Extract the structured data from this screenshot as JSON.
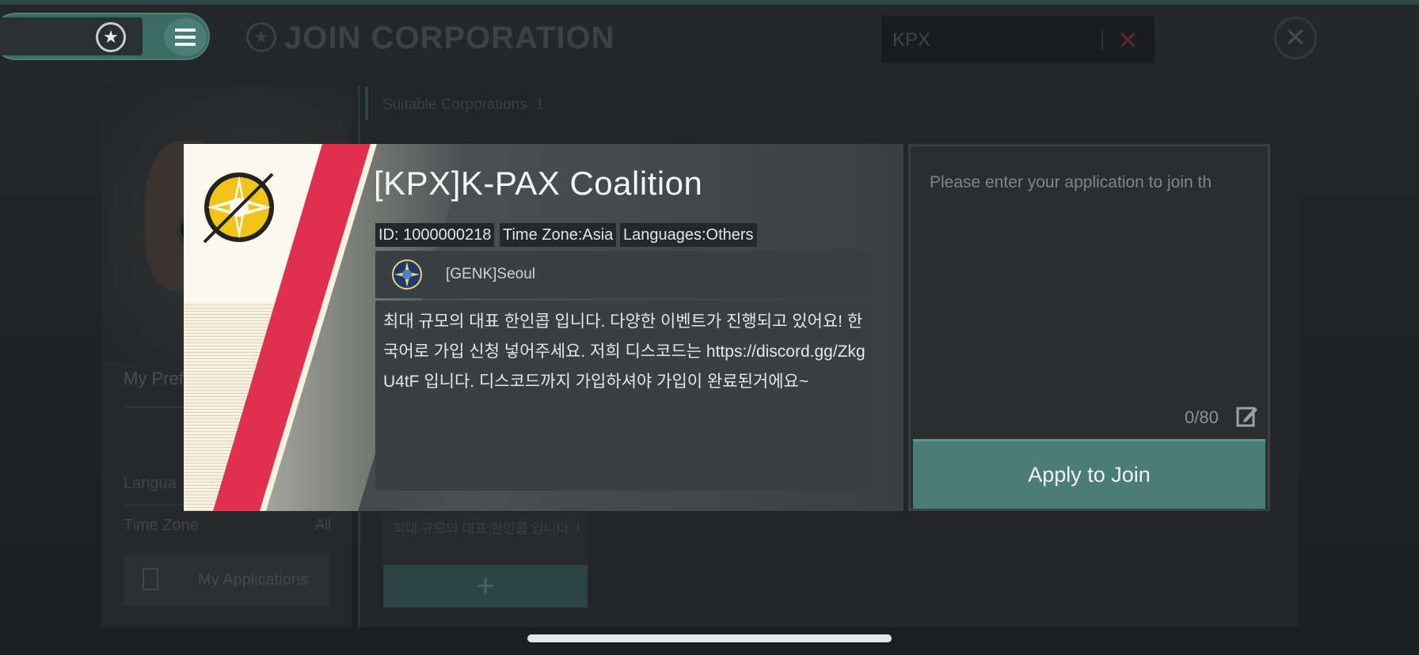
{
  "header": {
    "title": "JOIN CORPORATION",
    "search_value": "KPX"
  },
  "left_panel": {
    "preferences_label": "My Pref",
    "language_label": "Langua",
    "timezone_label": "Time Zone",
    "timezone_value": "All",
    "my_applications_label": "My Applications"
  },
  "results": {
    "suitable_label": "Suitable Corporations",
    "count": "1",
    "card_preview": "최대 규모의 대표 한인콥 입니다. 다양한 이벤트가 진행되고 있어...",
    "add_label": "+"
  },
  "corporation": {
    "name": "[KPX]K-PAX Coalition",
    "id": "ID: 1000000218",
    "time_zone": "Time Zone:Asia",
    "languages": "Languages:Others",
    "leader": "[GENK]Seoul",
    "description": "최대 규모의 대표 한인콥 입니다. 다양한 이벤트가 진행되고 있어요! 한국어로 가입 신청 넣어주세요. 저희 디스코드는 https://discord.gg/ZkgU4tF 입니다. 디스코드까지 가입하셔야 가입이 완료된거에요~"
  },
  "application": {
    "placeholder": "Please enter your application to join th",
    "counter": "0/80",
    "apply_label": "Apply to Join"
  },
  "colors": {
    "accent": "#4a7d75",
    "stripe_red": "#e0304f",
    "emblem_gold": "#f0c419"
  }
}
